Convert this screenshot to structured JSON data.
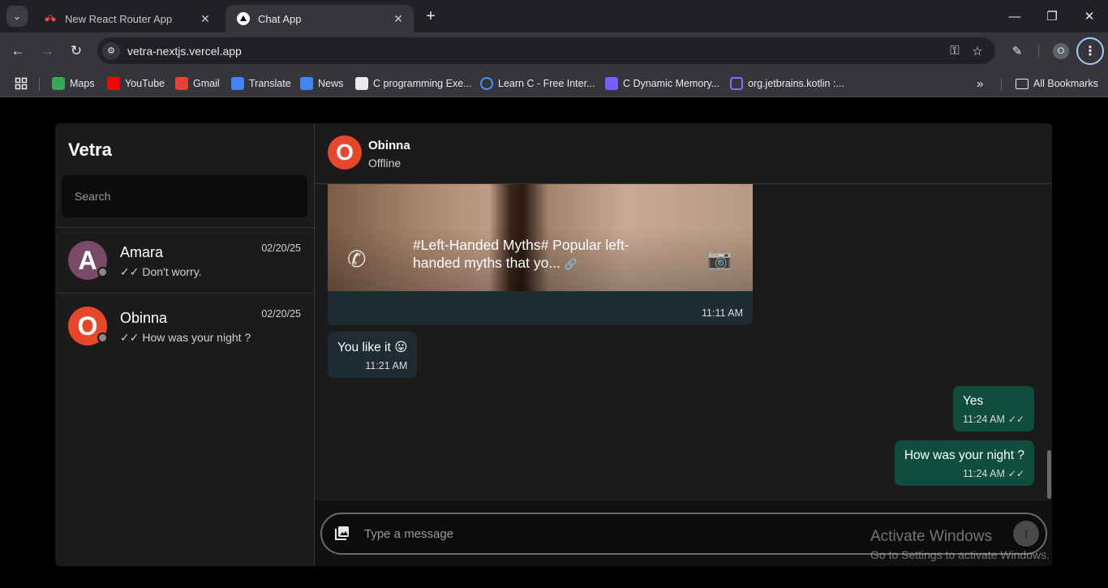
{
  "browser": {
    "tabs": [
      {
        "title": "New React Router App"
      },
      {
        "title": "Chat App"
      }
    ],
    "url": "vetra-nextjs.vercel.app",
    "profile_initial": "O",
    "bookmarks": [
      {
        "label": "Maps",
        "color": "#34a853"
      },
      {
        "label": "YouTube",
        "color": "#ff0000"
      },
      {
        "label": "Gmail",
        "color": "#ea4335"
      },
      {
        "label": "Translate",
        "color": "#4285f4"
      },
      {
        "label": "News",
        "color": "#4285f4"
      },
      {
        "label": "C programming Exe...",
        "color": "#e8eaed"
      },
      {
        "label": "Learn C - Free Inter...",
        "color": "#4a8cff"
      },
      {
        "label": "C Dynamic Memory...",
        "color": "#7b5cff"
      },
      {
        "label": "org.jetbrains.kotlin :...",
        "color": "#8a6cff"
      }
    ],
    "all_bookmarks_label": "All Bookmarks"
  },
  "app": {
    "brand": "Vetra",
    "search_placeholder": "Search",
    "contacts": [
      {
        "initial": "A",
        "name": "Amara",
        "last_message": "Don't worry.",
        "date": "02/20/25",
        "avatar_color": "#7b4a68"
      },
      {
        "initial": "O",
        "name": "Obinna",
        "last_message": "How was your night ?",
        "date": "02/20/25",
        "avatar_color": "#e8462a"
      }
    ],
    "chat": {
      "contact_initial": "O",
      "contact_name": "Obinna",
      "contact_status": "Offline",
      "media_message": {
        "caption": "#Left-Handed Myths# Popular left-handed myths that yo...",
        "time": "11:11 AM"
      },
      "messages": [
        {
          "text": "You like it 😛",
          "time": "11:21 AM",
          "direction": "in"
        },
        {
          "text": "Yes",
          "time": "11:24 AM",
          "direction": "out"
        },
        {
          "text": "How was your night ?",
          "time": "11:24 AM",
          "direction": "out"
        }
      ],
      "input_placeholder": "Type a message"
    }
  },
  "os_watermark": {
    "title": "Activate Windows",
    "subtitle": "Go to Settings to activate Windows."
  }
}
